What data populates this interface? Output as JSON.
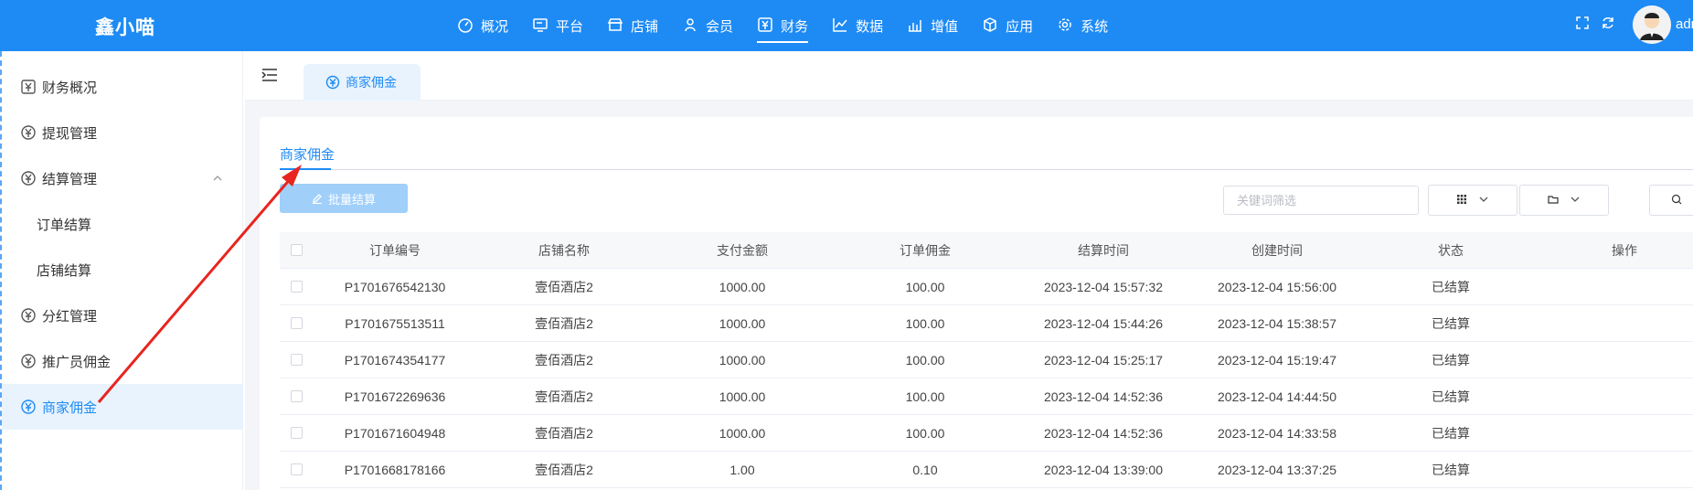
{
  "header": {
    "logo": "鑫小喵",
    "nav": [
      {
        "label": "概况",
        "icon": "dashboard-icon"
      },
      {
        "label": "平台",
        "icon": "monitor-icon"
      },
      {
        "label": "店铺",
        "icon": "store-icon"
      },
      {
        "label": "会员",
        "icon": "user-icon"
      },
      {
        "label": "财务",
        "icon": "finance-icon",
        "active": true
      },
      {
        "label": "数据",
        "icon": "chart-line-icon"
      },
      {
        "label": "增值",
        "icon": "bar-chart-icon"
      },
      {
        "label": "应用",
        "icon": "cube-icon"
      },
      {
        "label": "系统",
        "icon": "gear-icon"
      }
    ],
    "admin_name": "adm",
    "accent_color": "#1e8bf5"
  },
  "sidebar": {
    "items": [
      {
        "label": "财务概况",
        "icon": "yen-box-icon"
      },
      {
        "label": "提现管理",
        "icon": "yen-circle-icon"
      },
      {
        "label": "结算管理",
        "icon": "yen-circle-icon"
      },
      {
        "label": "订单结算"
      },
      {
        "label": "店铺结算"
      },
      {
        "label": "分红管理",
        "icon": "yen-circle-icon"
      },
      {
        "label": "推广员佣金",
        "icon": "yen-circle-icon"
      },
      {
        "label": "商家佣金",
        "icon": "yen-circle-icon",
        "active": true
      }
    ]
  },
  "page_tab": {
    "label": "商家佣金"
  },
  "inner_tab": {
    "label": "商家佣金"
  },
  "toolbar": {
    "batch_label": "批量结算",
    "filter_placeholder": "关键词筛选"
  },
  "table": {
    "headers": [
      "订单编号",
      "店铺名称",
      "支付金额",
      "订单佣金",
      "结算时间",
      "创建时间",
      "状态",
      "操作"
    ],
    "rows": [
      [
        "P1701676542130",
        "壹佰酒店2",
        "1000.00",
        "100.00",
        "2023-12-04 15:57:32",
        "2023-12-04 15:56:00",
        "已结算"
      ],
      [
        "P1701675513511",
        "壹佰酒店2",
        "1000.00",
        "100.00",
        "2023-12-04 15:44:26",
        "2023-12-04 15:38:57",
        "已结算"
      ],
      [
        "P1701674354177",
        "壹佰酒店2",
        "1000.00",
        "100.00",
        "2023-12-04 15:25:17",
        "2023-12-04 15:19:47",
        "已结算"
      ],
      [
        "P1701672269636",
        "壹佰酒店2",
        "1000.00",
        "100.00",
        "2023-12-04 14:52:36",
        "2023-12-04 14:44:50",
        "已结算"
      ],
      [
        "P1701671604948",
        "壹佰酒店2",
        "1000.00",
        "100.00",
        "2023-12-04 14:52:36",
        "2023-12-04 14:33:58",
        "已结算"
      ],
      [
        "P1701668178166",
        "壹佰酒店2",
        "1.00",
        "0.10",
        "2023-12-04 13:39:00",
        "2023-12-04 13:37:25",
        "已结算"
      ]
    ]
  },
  "annotation_color": "#e8251f"
}
